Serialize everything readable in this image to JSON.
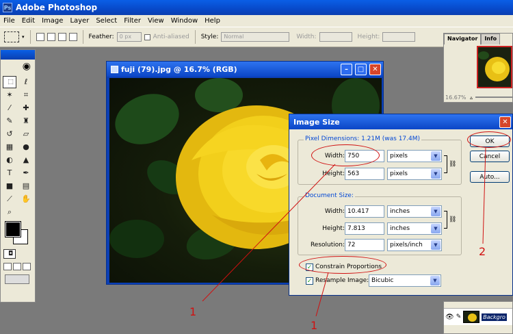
{
  "app": {
    "title": "Adobe Photoshop",
    "logo_text": "Ps"
  },
  "menu": [
    "File",
    "Edit",
    "Image",
    "Layer",
    "Select",
    "Filter",
    "View",
    "Window",
    "Help"
  ],
  "options": {
    "feather_label": "Feather:",
    "feather_value": "0 px",
    "antialias_label": "Anti-aliased",
    "style_label": "Style:",
    "style_value": "Normal",
    "width_label": "Width:",
    "height_label": "Height:"
  },
  "document": {
    "title": "fuji (79).jpg @ 16.7% (RGB)"
  },
  "navigator": {
    "tabs": [
      "Navigator",
      "Info"
    ],
    "zoom": "16.67%"
  },
  "layers": {
    "layer_name": "Backgro"
  },
  "dialog": {
    "title": "Image Size",
    "pixel_group": "Pixel Dimensions:  1.21M (was 17.4M)",
    "width_label": "Width:",
    "width_value": "750",
    "width_unit": "pixels",
    "height_label": "Height:",
    "height_value": "563",
    "height_unit": "pixels",
    "doc_group": "Document Size:",
    "doc_width_label": "Width:",
    "doc_width_value": "10.417",
    "doc_width_unit": "inches",
    "doc_height_label": "Height:",
    "doc_height_value": "7.813",
    "doc_height_unit": "inches",
    "resolution_label": "Resolution:",
    "resolution_value": "72",
    "resolution_unit": "pixels/inch",
    "constrain_label": "Constrain Proportions",
    "resample_label": "Resample Image:",
    "resample_value": "Bicubic",
    "ok_label": "OK",
    "cancel_label": "Cancel",
    "auto_label": "Auto..."
  },
  "annotations": {
    "num1a": "1",
    "num1b": "1",
    "num2": "2",
    "color": "#d01010"
  }
}
